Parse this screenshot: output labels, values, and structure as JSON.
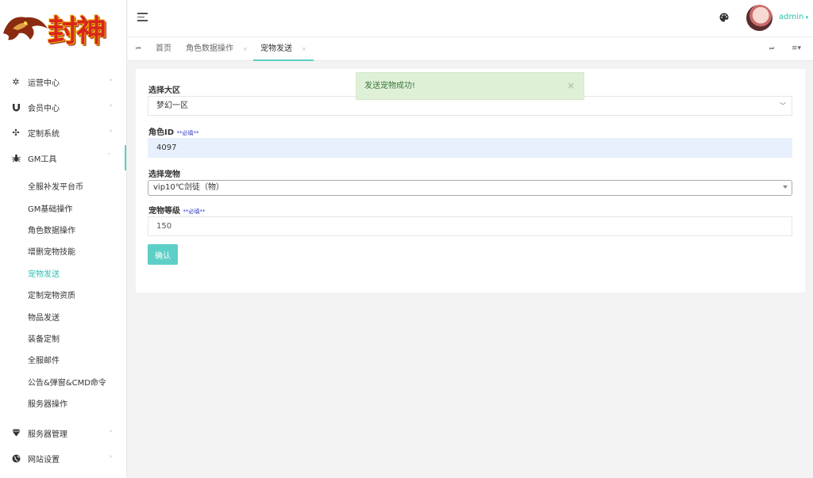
{
  "logo": {
    "text": "封神"
  },
  "header": {
    "username": "admin"
  },
  "sidebar": {
    "items": [
      {
        "label": "运营中心"
      },
      {
        "label": "会员中心"
      },
      {
        "label": "定制系统"
      },
      {
        "label": "GM工具"
      }
    ],
    "submenu": [
      {
        "label": "全服补发平台币"
      },
      {
        "label": "GM基础操作"
      },
      {
        "label": "角色数据操作"
      },
      {
        "label": "增删宠物技能"
      },
      {
        "label": "宠物发送"
      },
      {
        "label": "定制宠物资质"
      },
      {
        "label": "物品发送"
      },
      {
        "label": "装备定制"
      },
      {
        "label": "全服邮件"
      },
      {
        "label": "公告&弹窗&CMD命令"
      },
      {
        "label": "服务器操作"
      }
    ],
    "bottom_items": [
      {
        "label": "服务器管理"
      },
      {
        "label": "网站设置"
      }
    ]
  },
  "tabs": [
    {
      "label": "首页"
    },
    {
      "label": "角色数据操作"
    },
    {
      "label": "宠物发送"
    }
  ],
  "form": {
    "zone_label": "选择大区",
    "zone_value": "梦幻一区",
    "role_label": "角色ID",
    "required_text": "**必填**",
    "role_value": "4097",
    "pet_label": "选择宠物",
    "pet_value": "vip10℃剑徒（物）",
    "level_label": "宠物等级",
    "level_value": "150",
    "submit_label": "确认"
  },
  "toast": {
    "message": "发送宠物成功!",
    "close": "×"
  },
  "colors": {
    "accent": "#5ecfc6",
    "success_bg": "#dff0d8",
    "success_text": "#3c763d"
  }
}
